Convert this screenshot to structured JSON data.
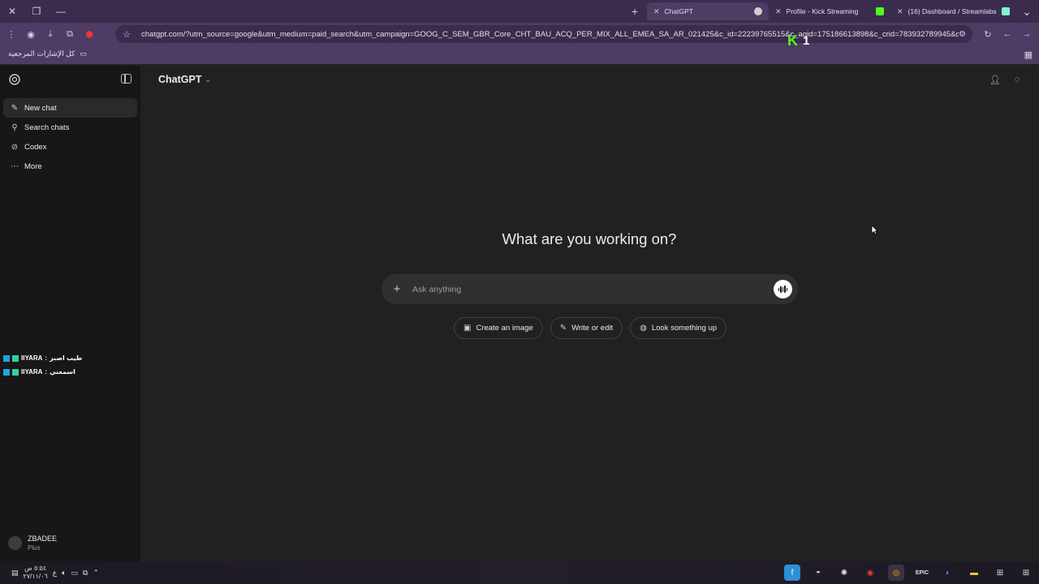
{
  "browser": {
    "tabs": [
      {
        "title": "ChatGPT",
        "active": true
      },
      {
        "title": "Profile - Kick Streaming",
        "active": false
      },
      {
        "title": "(16) Dashboard / Streamlabs",
        "active": false
      }
    ],
    "url": "chatgpt.com/?utm_source=google&utm_medium=paid_search&utm_campaign=GOOG_C_SEM_GBR_Core_CHT_BAU_ACQ_PER_MIX_ALL_EMEA_SA_AR_021425&c_id=22239765515&c_agid=175186613898&c_crid=783932789945&c_kwid=...",
    "bookmarks_label": "كل الإشارات المرجعية",
    "overlay": {
      "letter": "K",
      "count": "1"
    }
  },
  "sidebar": {
    "items": [
      {
        "label": "New chat",
        "icon": "edit-icon"
      },
      {
        "label": "Search chats",
        "icon": "search-icon"
      },
      {
        "label": "Codex",
        "icon": "codex-icon"
      },
      {
        "label": "More",
        "icon": "more-icon"
      }
    ],
    "chat_notes": [
      {
        "user": "IIYARA",
        "text": "طيب اصبر"
      },
      {
        "user": "IIYARA",
        "text": "اسمعني"
      }
    ],
    "user": {
      "name": "ZBADEE",
      "plan": "Plus"
    }
  },
  "header": {
    "title": "ChatGPT"
  },
  "main": {
    "heading": "What are you working on?",
    "composer": {
      "placeholder": "Ask anything"
    },
    "chips": [
      {
        "label": "Create an image",
        "icon": "image-icon"
      },
      {
        "label": "Write or edit",
        "icon": "pencil-icon"
      },
      {
        "label": "Look something up",
        "icon": "globe-icon"
      }
    ]
  },
  "taskbar": {
    "time": "٥:٥٤ ص",
    "date": "٢٧/١١/٠٦",
    "lang": "ع"
  },
  "colors": {
    "chrome_bg": "#3b2c4e",
    "toolbar_bg": "#4d3c63",
    "sidebar_bg": "#171717",
    "main_bg": "#212121",
    "composer_bg": "#303030",
    "kick_green": "#53fc18"
  }
}
